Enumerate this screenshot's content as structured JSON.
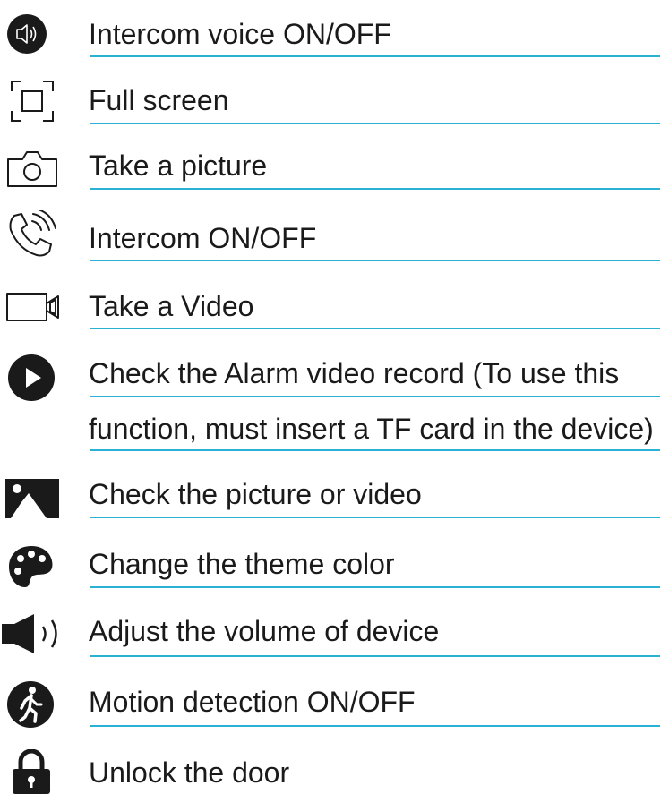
{
  "legend": {
    "items": [
      {
        "icon": "speaker-toggle-icon",
        "label": "Intercom voice ON/OFF"
      },
      {
        "icon": "fullscreen-icon",
        "label": "Full screen"
      },
      {
        "icon": "camera-icon",
        "label": "Take a picture"
      },
      {
        "icon": "phone-call-icon",
        "label": "Intercom ON/OFF"
      },
      {
        "icon": "video-camera-icon",
        "label": "Take a Video"
      },
      {
        "icon": "play-icon",
        "label_line1": "Check the Alarm video record (To use this",
        "label_line2": "function, must insert a TF card in the device)"
      },
      {
        "icon": "gallery-icon",
        "label": "Check the picture or video"
      },
      {
        "icon": "palette-icon",
        "label": "Change the theme color"
      },
      {
        "icon": "volume-icon",
        "label": "Adjust the volume of device"
      },
      {
        "icon": "motion-walker-icon",
        "label": "Motion detection ON/OFF"
      },
      {
        "icon": "lock-icon",
        "label": "Unlock the door"
      }
    ]
  },
  "colors": {
    "rule": "#29b2d3",
    "text": "#1a1a1a",
    "icon": "#1a1a1a"
  }
}
